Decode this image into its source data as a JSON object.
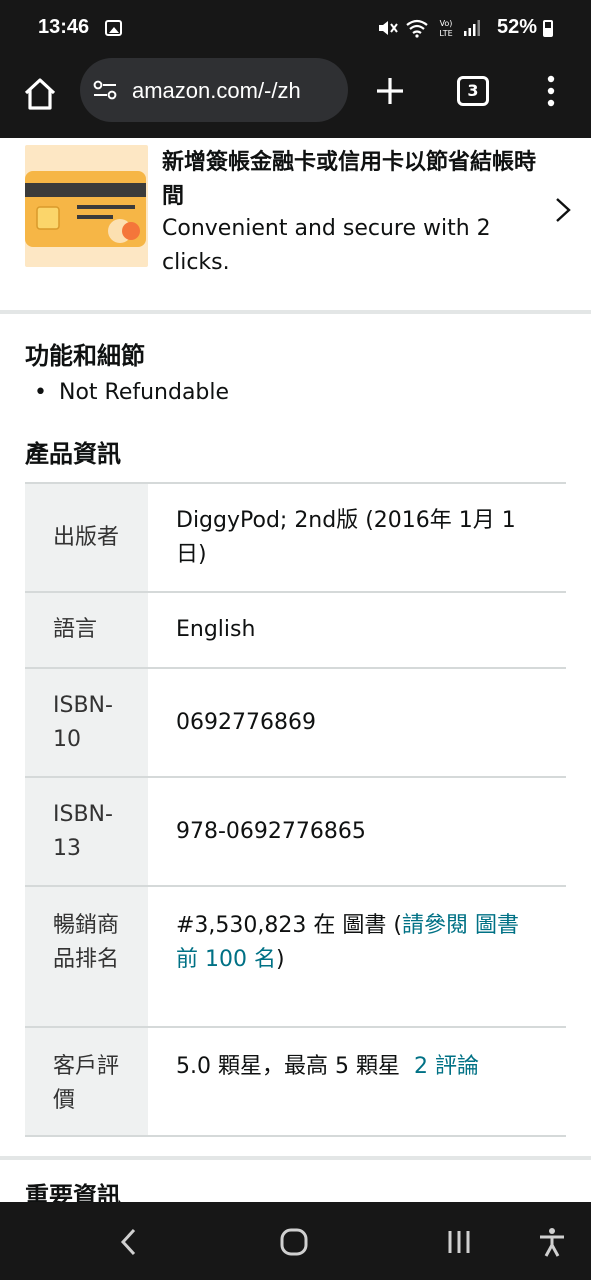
{
  "status_bar": {
    "time": "13:46",
    "battery": "52%"
  },
  "browser": {
    "url": "amazon.com/-/zh",
    "tab_count": "3"
  },
  "promo": {
    "title": "新增簽帳金融卡或信用卡以節省結帳時間",
    "subtitle": "Convenient and secure with 2 clicks."
  },
  "features": {
    "heading": "功能和細節",
    "bullets": [
      "Not Refundable"
    ]
  },
  "product_info": {
    "heading": "產品資訊",
    "rows": [
      {
        "key": "出版者",
        "value": "DiggyPod; 2nd版 (2016年 1月 1日)"
      },
      {
        "key": "語言",
        "value": "English"
      },
      {
        "key": "ISBN-10",
        "value": "0692776869"
      },
      {
        "key": "ISBN-13",
        "value": "978-0692776865"
      },
      {
        "key": "暢銷商品排名",
        "value_prefix": "#3,530,823 在 圖書 (",
        "value_link": "請參閱 圖書前 100 名",
        "value_suffix": ")"
      },
      {
        "key": "客戶評價",
        "value": "5.0 顆星，最高 5 顆星",
        "value_link": "2 評論"
      }
    ]
  },
  "next_section": {
    "heading": "重要資訊"
  },
  "colors": {
    "link": "#007185",
    "divider": "#e3e6e6",
    "table_key_bg": "#eff1f1",
    "chrome": "#171717"
  }
}
